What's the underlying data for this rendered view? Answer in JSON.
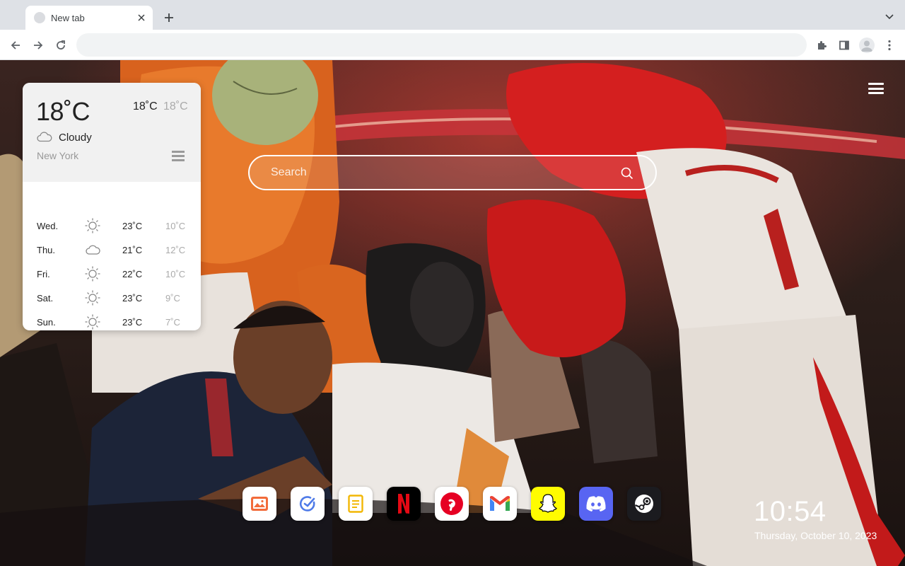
{
  "browser": {
    "tab_title": "New tab",
    "omnibox_value": ""
  },
  "weather": {
    "current_temp": "18˚C",
    "high": "18˚C",
    "low": "18˚C",
    "condition": "Cloudy",
    "condition_icon": "cloud-icon",
    "city": "New York",
    "forecast": [
      {
        "day": "Wed.",
        "icon": "sun-icon",
        "high": "23˚C",
        "low": "10˚C"
      },
      {
        "day": "Thu.",
        "icon": "cloud-icon",
        "high": "21˚C",
        "low": "12˚C"
      },
      {
        "day": "Fri.",
        "icon": "sun-icon",
        "high": "22˚C",
        "low": "10˚C"
      },
      {
        "day": "Sat.",
        "icon": "sun-icon",
        "high": "23˚C",
        "low": "9˚C"
      },
      {
        "day": "Sun.",
        "icon": "sun-icon",
        "high": "23˚C",
        "low": "7˚C"
      }
    ]
  },
  "search": {
    "placeholder": "Search"
  },
  "quick_links": [
    {
      "name": "wallpapers",
      "icon": "image-icon",
      "bg": "#ffffff"
    },
    {
      "name": "todo",
      "icon": "check-circle-icon",
      "bg": "#ffffff"
    },
    {
      "name": "notes",
      "icon": "note-icon",
      "bg": "#ffffff"
    },
    {
      "name": "netflix",
      "icon": "netflix-icon",
      "bg": "#000000"
    },
    {
      "name": "pinterest",
      "icon": "pinterest-icon",
      "bg": "#ffffff"
    },
    {
      "name": "gmail",
      "icon": "gmail-icon",
      "bg": "#ffffff"
    },
    {
      "name": "snapchat",
      "icon": "snapchat-icon",
      "bg": "#fffc00"
    },
    {
      "name": "discord",
      "icon": "discord-icon",
      "bg": "#5865f2"
    },
    {
      "name": "steam",
      "icon": "steam-icon",
      "bg": "#1b1b1f"
    }
  ],
  "clock": {
    "time": "10:54",
    "date": "Thursday, October 10, 2023"
  }
}
